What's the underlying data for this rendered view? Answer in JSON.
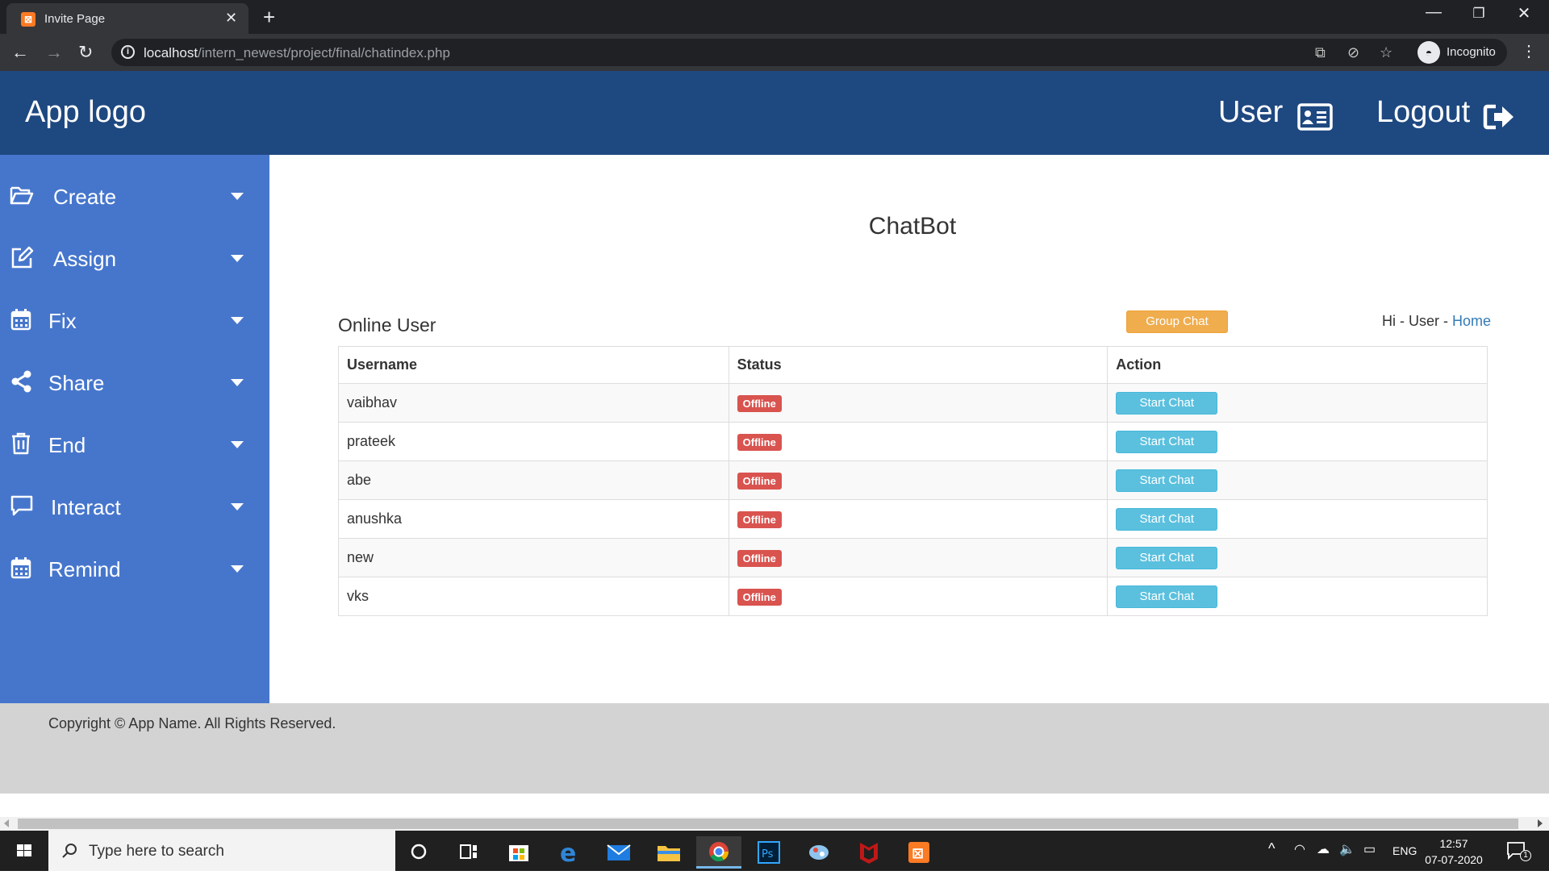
{
  "browser": {
    "tab_title": "Invite Page",
    "url_host": "localhost",
    "url_path": "/intern_newest/project/final/chatindex.php",
    "profile_label": "Incognito"
  },
  "header": {
    "logo": "App logo",
    "user_label": "User",
    "logout_label": "Logout"
  },
  "sidebar": {
    "items": [
      {
        "label": "Create",
        "icon": "folder-open-icon"
      },
      {
        "label": "Assign",
        "icon": "edit-icon"
      },
      {
        "label": "Fix",
        "icon": "calendar-icon"
      },
      {
        "label": "Share",
        "icon": "share-icon"
      },
      {
        "label": "End",
        "icon": "trash-icon"
      },
      {
        "label": "Interact",
        "icon": "comment-icon"
      },
      {
        "label": "Remind",
        "icon": "calendar-icon"
      }
    ]
  },
  "main": {
    "title": "ChatBot",
    "section_heading": "Online User",
    "group_chat_label": "Group Chat",
    "greeting_prefix": "Hi - User - ",
    "home_link": "Home",
    "table": {
      "headers": [
        "Username",
        "Status",
        "Action"
      ],
      "rows": [
        {
          "username": "vaibhav",
          "status": "Offline",
          "action": "Start Chat"
        },
        {
          "username": "prateek",
          "status": "Offline",
          "action": "Start Chat"
        },
        {
          "username": "abe",
          "status": "Offline",
          "action": "Start Chat"
        },
        {
          "username": "anushka",
          "status": "Offline",
          "action": "Start Chat"
        },
        {
          "username": "new",
          "status": "Offline",
          "action": "Start Chat"
        },
        {
          "username": "vks",
          "status": "Offline",
          "action": "Start Chat"
        }
      ]
    }
  },
  "footer": {
    "copyright": "Copyright © App Name. All Rights Reserved."
  },
  "taskbar": {
    "search_placeholder": "Type here to search",
    "language": "ENG",
    "time": "12:57",
    "date": "07-07-2020",
    "notification_count": "1"
  },
  "colors": {
    "header_bg": "#1e4880",
    "sidebar_bg": "#4676cc",
    "badge_offline": "#d9534f",
    "start_chat_button": "#5bc0de",
    "group_chat_button": "#f0ad4e",
    "link": "#337ab7"
  }
}
